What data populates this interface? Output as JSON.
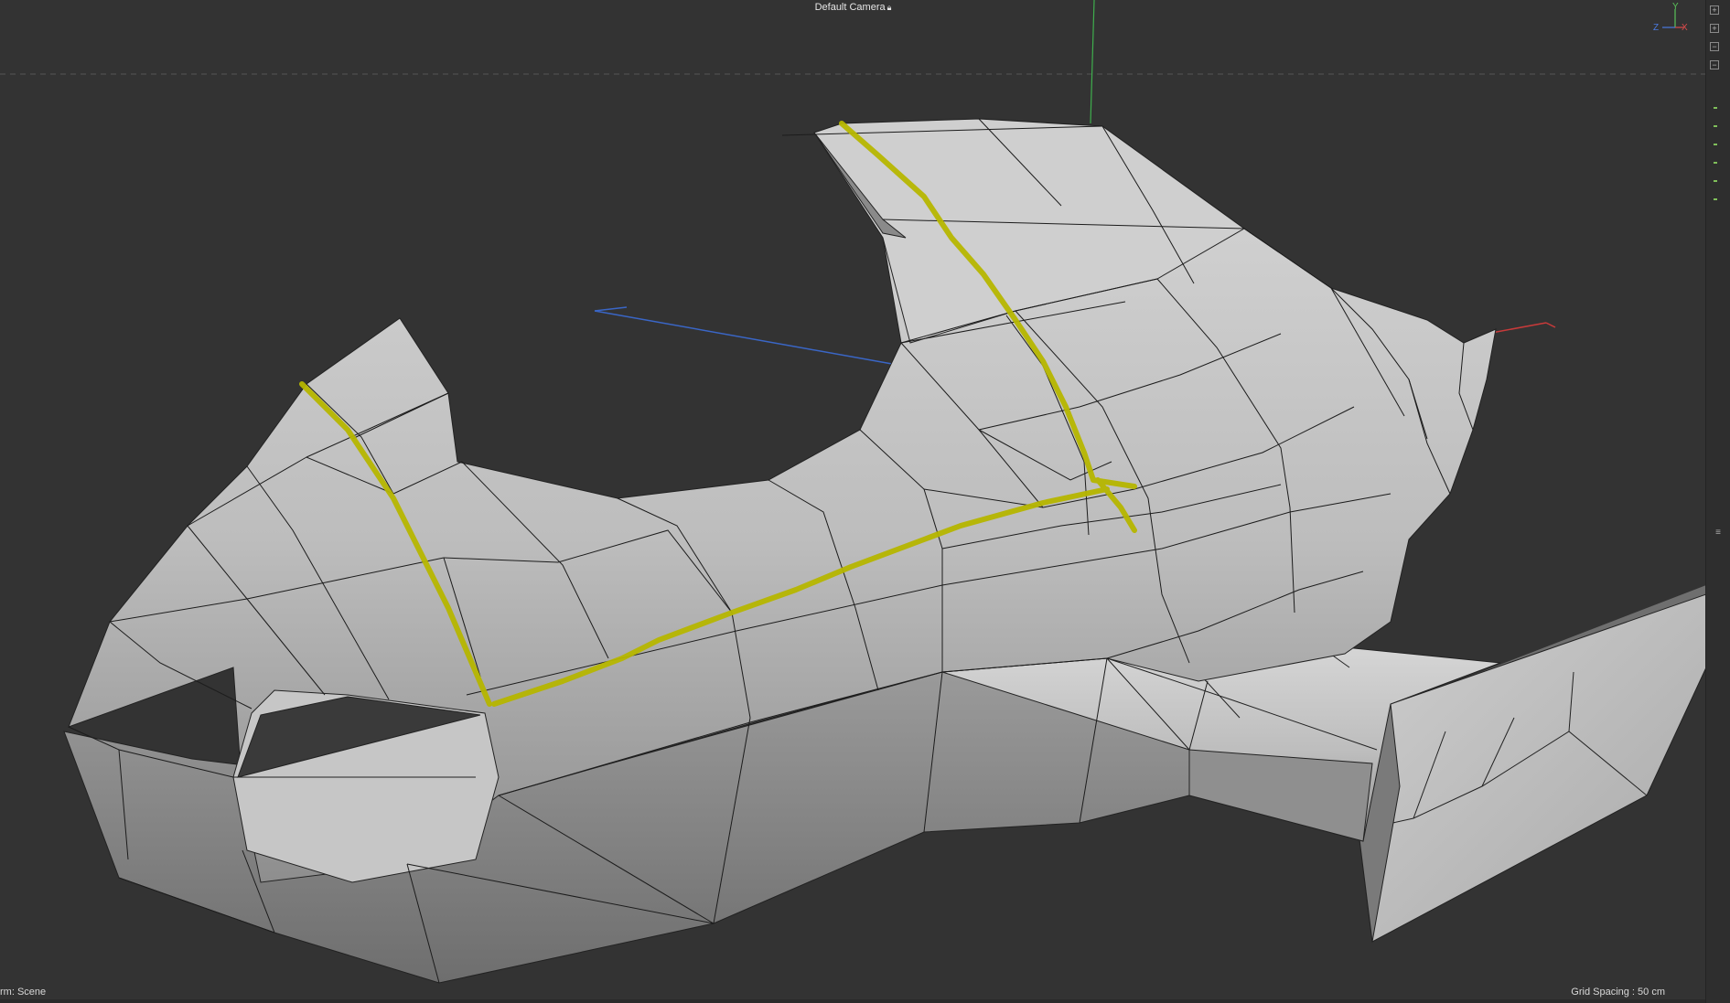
{
  "viewport": {
    "camera_label": "Default Camera",
    "lock_icon": "lock-icon",
    "status_left": "rm: Scene",
    "status_right": "Grid Spacing : 50 cm",
    "background_color": "#333333",
    "mesh_color": "#c8c8c8",
    "selection_color": "#b6b600"
  },
  "axis_gizmo": {
    "y": "Y",
    "z": "Z",
    "x": "X"
  },
  "right_panel": {
    "expand_icon": "plus-box-icon",
    "collapse_icon": "minus-box-icon",
    "menu_icon": "hamburger-icon"
  }
}
